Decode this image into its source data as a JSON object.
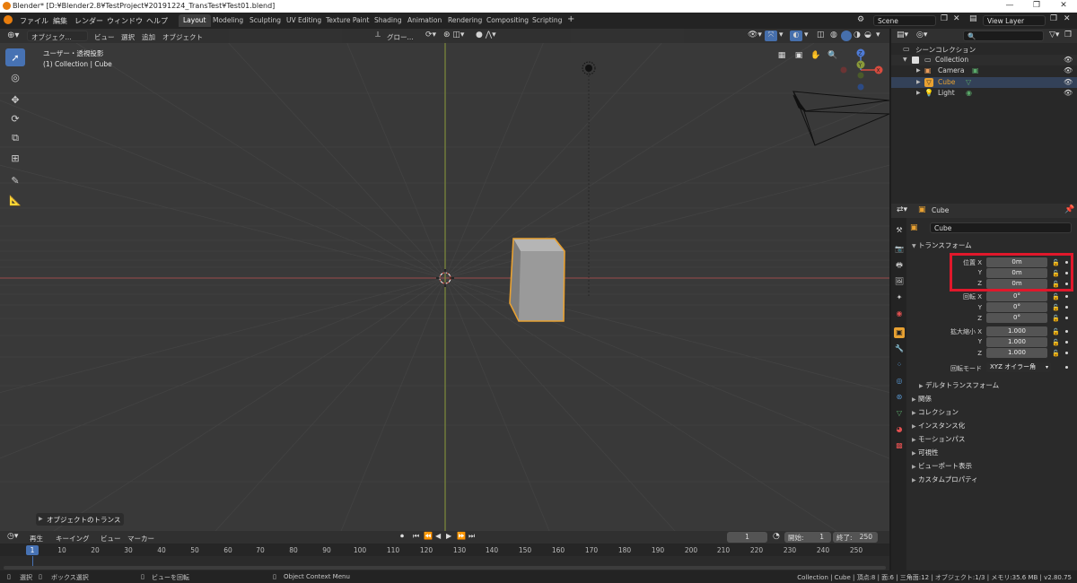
{
  "window": {
    "title": "Blender* [D:¥Blender2.8¥TestProject¥20191224_TransTest¥Test01.blend]",
    "minimize": "—",
    "maximize": "❐",
    "close": "✕"
  },
  "menubar": {
    "items": [
      "ファイル",
      "編集",
      "レンダー",
      "ウィンドウ",
      "ヘルプ"
    ],
    "workspaces": [
      "Layout",
      "Modeling",
      "Sculpting",
      "UV Editing",
      "Texture Paint",
      "Shading",
      "Animation",
      "Rendering",
      "Compositing",
      "Scripting"
    ],
    "active_workspace": "Layout",
    "add_tab": "+",
    "scene_label": "Scene",
    "view_layer_label": "View Layer"
  },
  "viewport": {
    "mode": "オブジェク...",
    "menus": [
      "ビュー",
      "選択",
      "追加",
      "オブジェクト"
    ],
    "transform_orientation": "グロー...",
    "view_name": "ユーザー・透視投影",
    "collection_info": "(1) Collection | Cube",
    "last_operation": "オブジェクトのトランス",
    "gizmo_axes": {
      "x": "X",
      "y": "Y",
      "z": "Z"
    },
    "colors": {
      "background": "#393939",
      "grid": "#444444",
      "x_axis": "#9c4a4a",
      "y_axis": "#8a9a3a",
      "selection": "#e8a132",
      "cube": "#9a9a9a"
    }
  },
  "timeline": {
    "menus": [
      "再生",
      "キーイング",
      "ビュー",
      "マーカー"
    ],
    "current_frame": "1",
    "start_label": "開始:",
    "start": "1",
    "end_label": "終了:",
    "end": "250",
    "frame_marks": [
      "1",
      "10",
      "20",
      "30",
      "40",
      "50",
      "60",
      "70",
      "80",
      "90",
      "100",
      "110",
      "120",
      "130",
      "140",
      "150",
      "160",
      "170",
      "180",
      "190",
      "200",
      "210",
      "220",
      "230",
      "240",
      "250"
    ]
  },
  "statusbar": {
    "select": "選択",
    "box_select": "ボックス選択",
    "rotate_view": "ビューを回転",
    "context_menu": "Object Context Menu",
    "stats": "Collection | Cube | 頂点:8 | 面:6 | 三角面:12 | オブジェクト:1/3 | メモリ:35.6 MB | v2.80.75"
  },
  "outliner": {
    "root": "シーンコレクション",
    "collection": "Collection",
    "items": [
      {
        "name": "Camera",
        "color": "#e89b5a"
      },
      {
        "name": "Cube",
        "color": "#e8a132",
        "selected": true
      },
      {
        "name": "Light",
        "color": "#e8c15a"
      }
    ]
  },
  "properties": {
    "object_name_header": "Cube",
    "object_name": "Cube",
    "transform_header": "トランスフォーム",
    "location_label": "位置 X",
    "location": [
      "0m",
      "0m",
      "0m"
    ],
    "rotation_label": "回転 X",
    "rotation": [
      "0°",
      "0°",
      "0°"
    ],
    "scale_label": "拡大縮小 X",
    "scale": [
      "1.000",
      "1.000",
      "1.000"
    ],
    "axis_y": "Y",
    "axis_z": "Z",
    "rotation_mode_label": "回転モード",
    "rotation_mode": "XYZ オイラー角",
    "delta_transform": "デルタトランスフォーム",
    "sections": [
      "関係",
      "コレクション",
      "インスタンス化",
      "モーションパス",
      "可視性",
      "ビューポート表示",
      "カスタムプロパティ"
    ]
  }
}
